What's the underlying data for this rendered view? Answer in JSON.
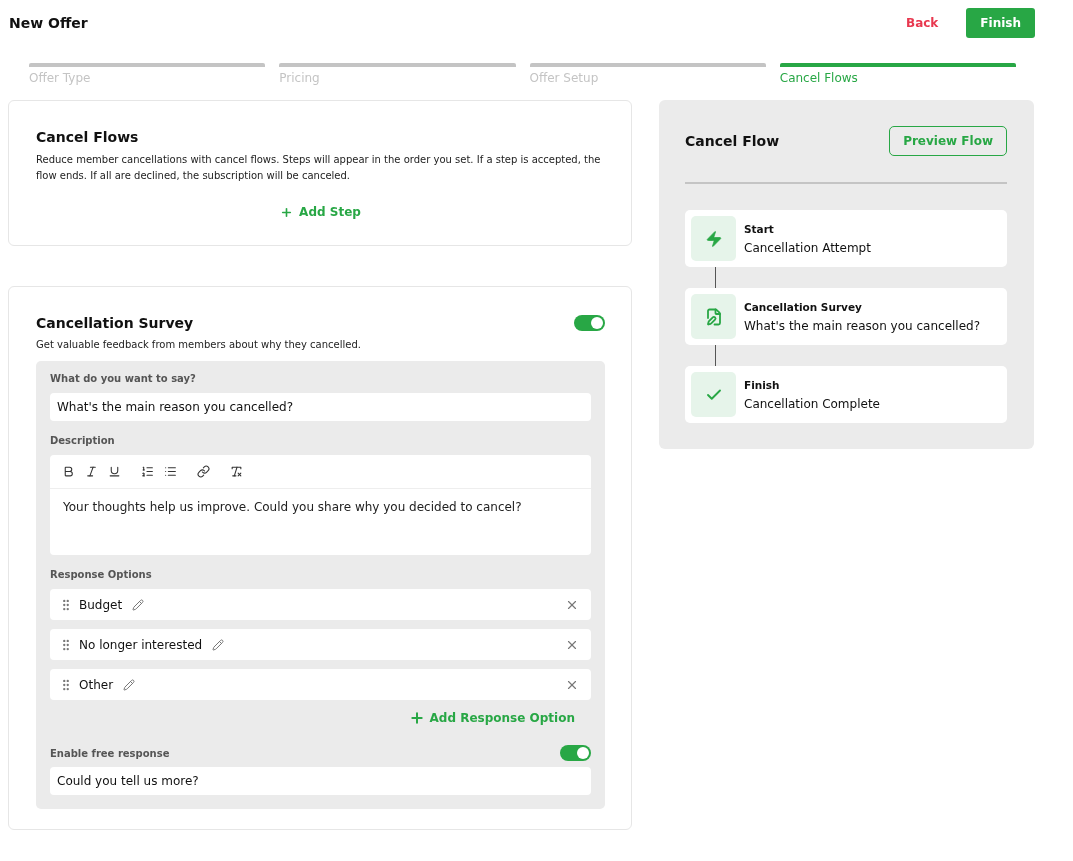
{
  "header": {
    "title": "New Offer",
    "back_label": "Back",
    "finish_label": "Finish"
  },
  "steps": [
    {
      "label": "Offer Type",
      "selected": false
    },
    {
      "label": "Pricing",
      "selected": false
    },
    {
      "label": "Offer Setup",
      "selected": false
    },
    {
      "label": "Cancel Flows",
      "selected": true
    }
  ],
  "cancel_flows": {
    "title": "Cancel Flows",
    "description": "Reduce member cancellations with cancel flows. Steps will appear in the order you set. If a step is accepted, the flow ends. If all are declined, the subscription will be canceled.",
    "add_step_label": "Add Step"
  },
  "survey": {
    "title": "Cancellation Survey",
    "on": true,
    "description": "Get valuable feedback from members about why they cancelled.",
    "question_label": "What do you want to say?",
    "question_value": "What's the main reason you cancelled?",
    "description_label": "Description",
    "description_value": "Your thoughts help us improve. Could you share why you decided to cancel?",
    "response_label": "Response Options",
    "options": [
      {
        "label": "Budget"
      },
      {
        "label": "No longer interested"
      },
      {
        "label": "Other"
      }
    ],
    "add_option_label": "Add Response Option",
    "free_response": {
      "label": "Enable free response",
      "on": true,
      "value": "Could you tell us more?"
    }
  },
  "flow_panel": {
    "title": "Cancel Flow",
    "preview_label": "Preview Flow",
    "nodes": [
      {
        "kind": "start",
        "title": "Start",
        "subtitle": "Cancellation Attempt"
      },
      {
        "kind": "survey",
        "title": "Cancellation Survey",
        "subtitle": "What's the main reason you cancelled?"
      },
      {
        "kind": "finish",
        "title": "Finish",
        "subtitle": "Cancellation Complete"
      }
    ]
  }
}
